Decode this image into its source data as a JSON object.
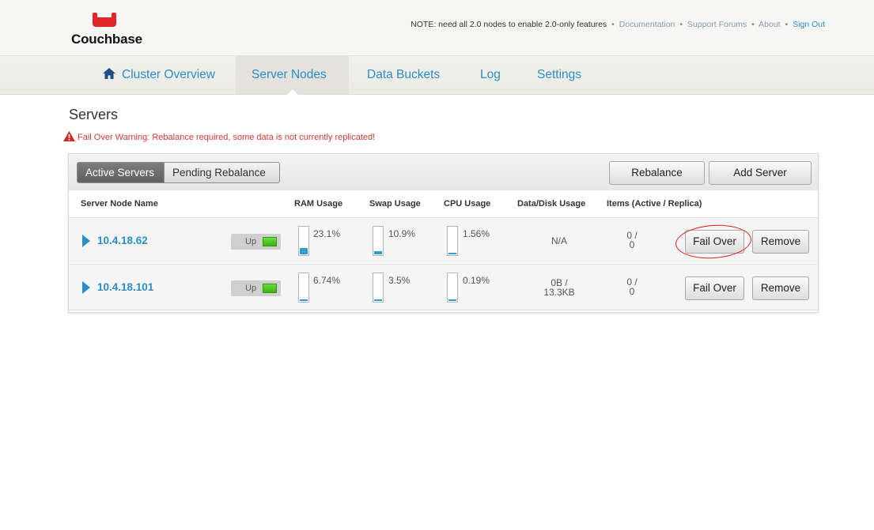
{
  "brand": {
    "name": "Couchbase",
    "color": "#e0262b"
  },
  "toplinks": {
    "note": "NOTE: need all 2.0 nodes to enable 2.0-only features",
    "documentation": "Documentation",
    "support": "Support Forums",
    "about": "About",
    "signout": "Sign Out",
    "separator": "•"
  },
  "nav": {
    "items": [
      {
        "label": "Cluster Overview",
        "icon": "home-icon"
      },
      {
        "label": "Server Nodes",
        "active": true
      },
      {
        "label": "Data Buckets"
      },
      {
        "label": "Log"
      },
      {
        "label": "Settings"
      }
    ]
  },
  "page": {
    "title": "Servers",
    "warning": "Fail Over Warning: Rebalance required, some data is not currently replicated!"
  },
  "toolbar": {
    "tab_active": "Active Servers",
    "tab_pending": "Pending Rebalance",
    "rebalance": "Rebalance",
    "add_server": "Add Server"
  },
  "columns": {
    "name": "Server Node Name",
    "ram": "RAM Usage",
    "swap": "Swap Usage",
    "cpu": "CPU Usage",
    "disk": "Data/Disk Usage",
    "items": "Items (Active / Replica)"
  },
  "servers": [
    {
      "name": "10.4.18.62",
      "status": "Up",
      "ram": "23.1%",
      "ram_fraction": 0.231,
      "swap": "10.9%",
      "swap_fraction": 0.109,
      "cpu": "1.56%",
      "cpu_fraction": 0.0156,
      "disk_line1": "N/A",
      "disk_line2": "",
      "items_line1": "0 /",
      "items_line2": "0",
      "failover": "Fail Over",
      "remove": "Remove",
      "failover_highlighted": true
    },
    {
      "name": "10.4.18.101",
      "status": "Up",
      "ram": "6.74%",
      "ram_fraction": 0.0674,
      "swap": "3.5%",
      "swap_fraction": 0.035,
      "cpu": "0.19%",
      "cpu_fraction": 0.0019,
      "disk_line1": "0B /",
      "disk_line2": "13.3KB",
      "items_line1": "0 /",
      "items_line2": "0",
      "failover": "Fail Over",
      "remove": "Remove",
      "failover_highlighted": false
    }
  ],
  "colors": {
    "link": "#2a8ec7",
    "warning": "#d43a2f",
    "status_green": "#37b316",
    "gauge": "#2a9fd6",
    "highlight": "#e01f1f"
  }
}
